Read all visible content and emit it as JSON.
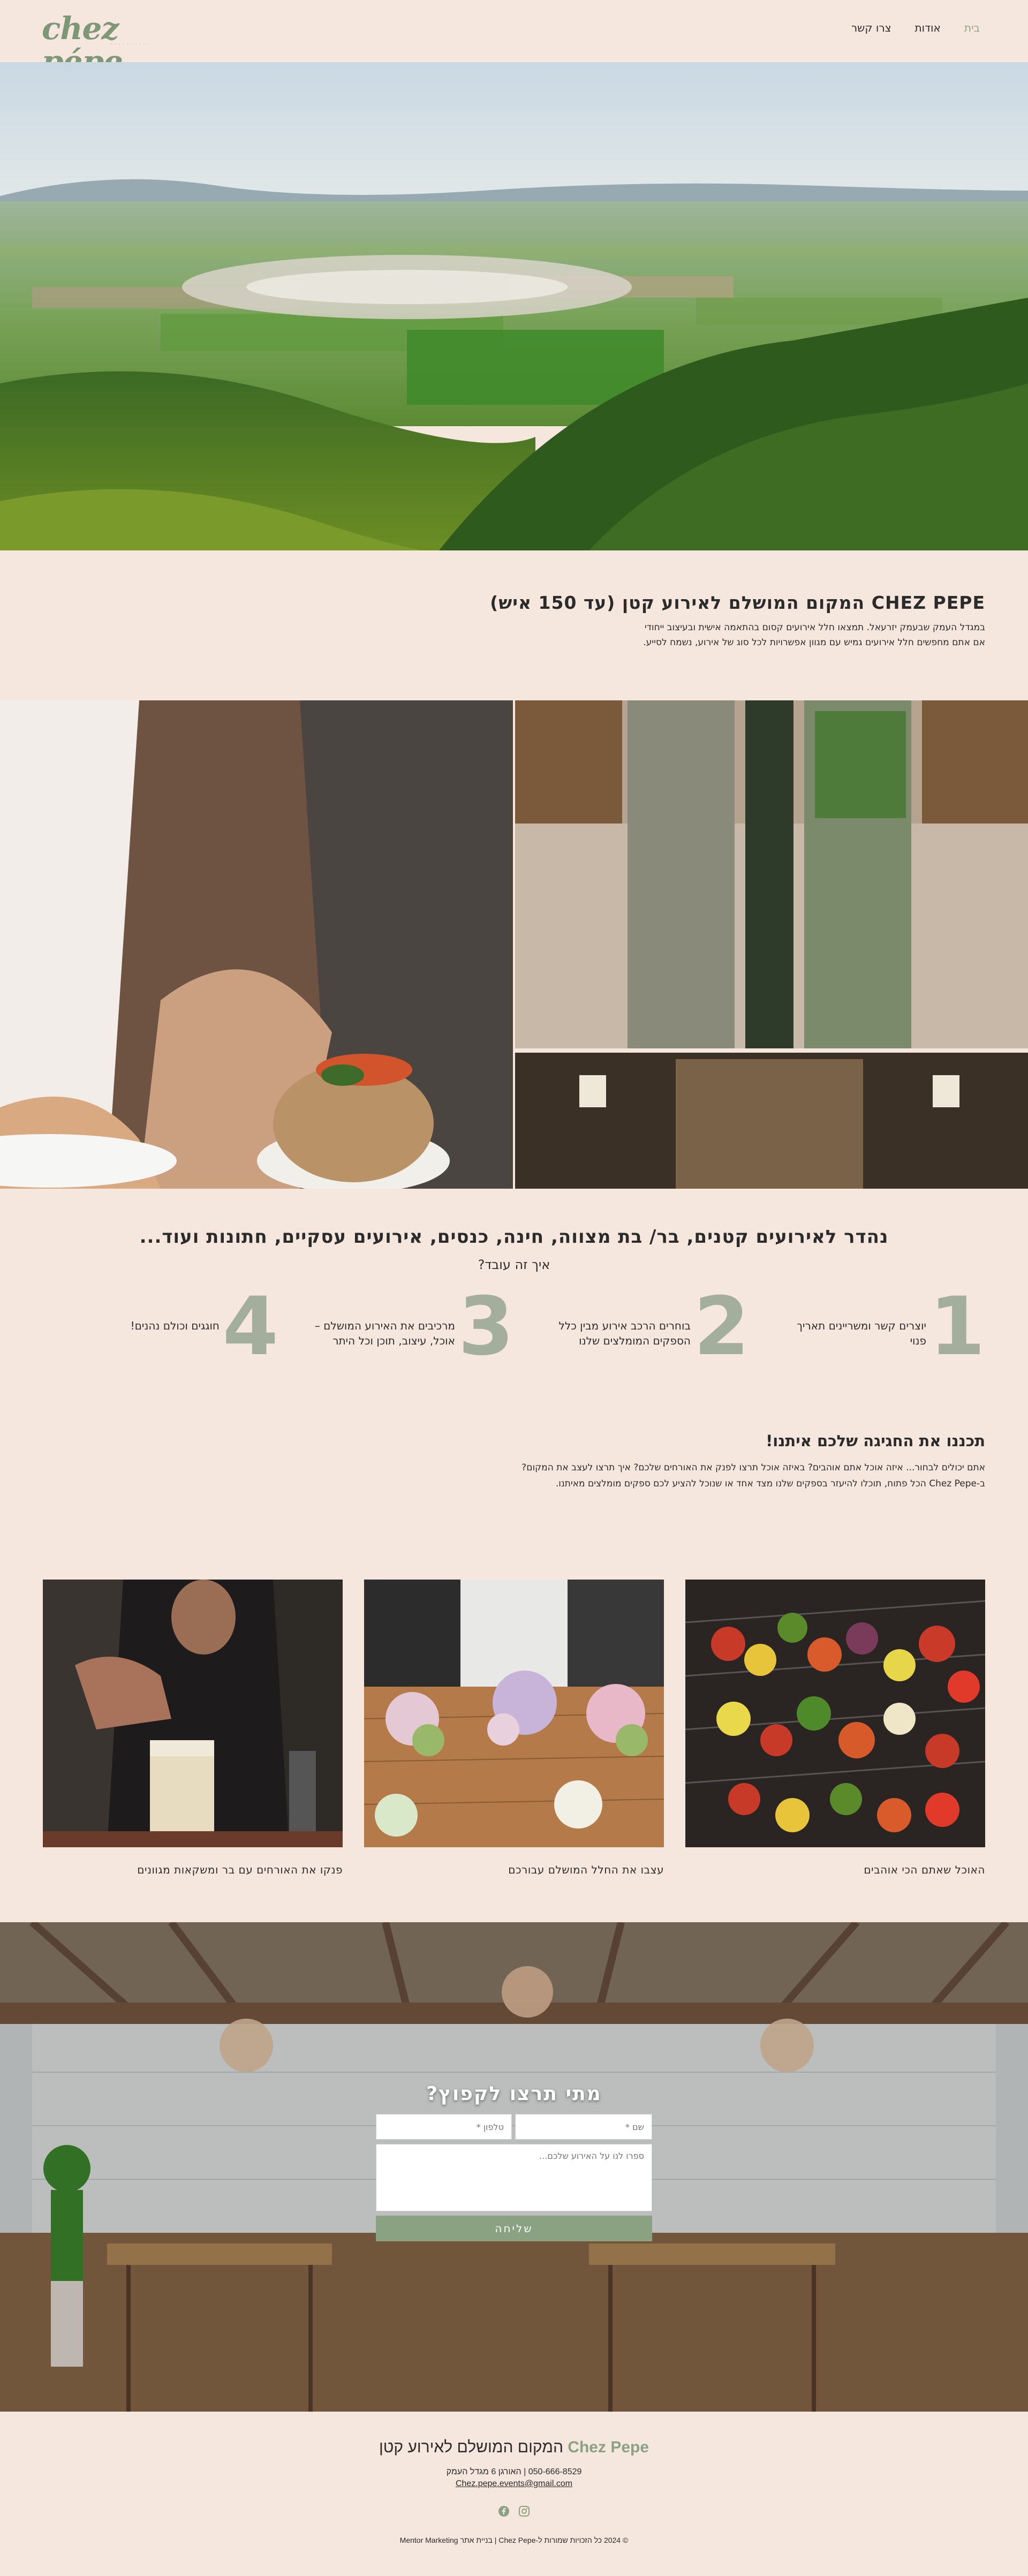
{
  "header": {
    "logo": "chez pépe",
    "nav": [
      "בית",
      "אודות",
      "צרו קשר"
    ]
  },
  "intro": {
    "title": "CHEZ PEPE המקום המושלם לאירוע קטן (עד 150 איש)",
    "line1": "במגדל העמק שבעמק יזרעאל. תמצאו חלל אירועים קסום בהתאמה אישית ובעיצוב ייחודי",
    "line2": "אם אתם מחפשים חלל אירועים גמיש עם מגוון אפשרויות לכל סוג של אירוע, נשמח לסייע."
  },
  "process": {
    "title": "נהדר לאירועים קטנים, בר/ בת מצווה, חינה, כנסים, אירועים עסקיים, חתונות ועוד...",
    "subtitle": "איך זה עובד?",
    "steps": [
      {
        "num": "1",
        "text": "יוצרים קשר ומשריינים תאריך פנוי"
      },
      {
        "num": "2",
        "text": "בוחרים הרכב אירוע מבין כלל הספקים המומלצים שלנו"
      },
      {
        "num": "3",
        "text": "מרכיבים את האירוע המושלם – אוכל, עיצוב, תוכן וכל היתר"
      },
      {
        "num": "4",
        "text": "חוגגים וכולם נהנים!"
      }
    ]
  },
  "plan": {
    "title": "תכננו את החגיגה שלכם איתנו!",
    "line1": "אתם יכולים לבחור... איזה אוכל אתם אוהבים? באיזה אוכל תרצו לפנק את האורחים שלכם? איך תרצו לעצב את המקום?",
    "line2": "ב-Chez Pepe הכל פתוח, תוכלו להיעזר בספקים שלנו מצד אחד או שנוכל להציע לכם ספקים מומלצים מאיתנו."
  },
  "cards": [
    {
      "caption": "האוכל שאתם הכי אוהבים"
    },
    {
      "caption": "עצבו את החלל המושלם עבורכם"
    },
    {
      "caption": "פנקו את האורחים עם בר ומשקאות מגוונים"
    }
  ],
  "contact": {
    "title": "מתי תרצו לקפוץ?",
    "name_placeholder": "שם *",
    "phone_placeholder": "טלפון *",
    "message_placeholder": "ספרו לנו על האירוע שלכם...",
    "send_label": "שליחה"
  },
  "footer": {
    "brand": "Chez Pepe",
    "tagline": "המקום המושלם לאירוע קטן",
    "address": "050-666-8529 | האורגן 6 מגדל העמק",
    "email": "Chez.pepe.events@gmail.com",
    "copyright": "© 2024 כל הזכויות שמורות ל-Chez Pepe | בניית אתר Mentor Marketing"
  }
}
